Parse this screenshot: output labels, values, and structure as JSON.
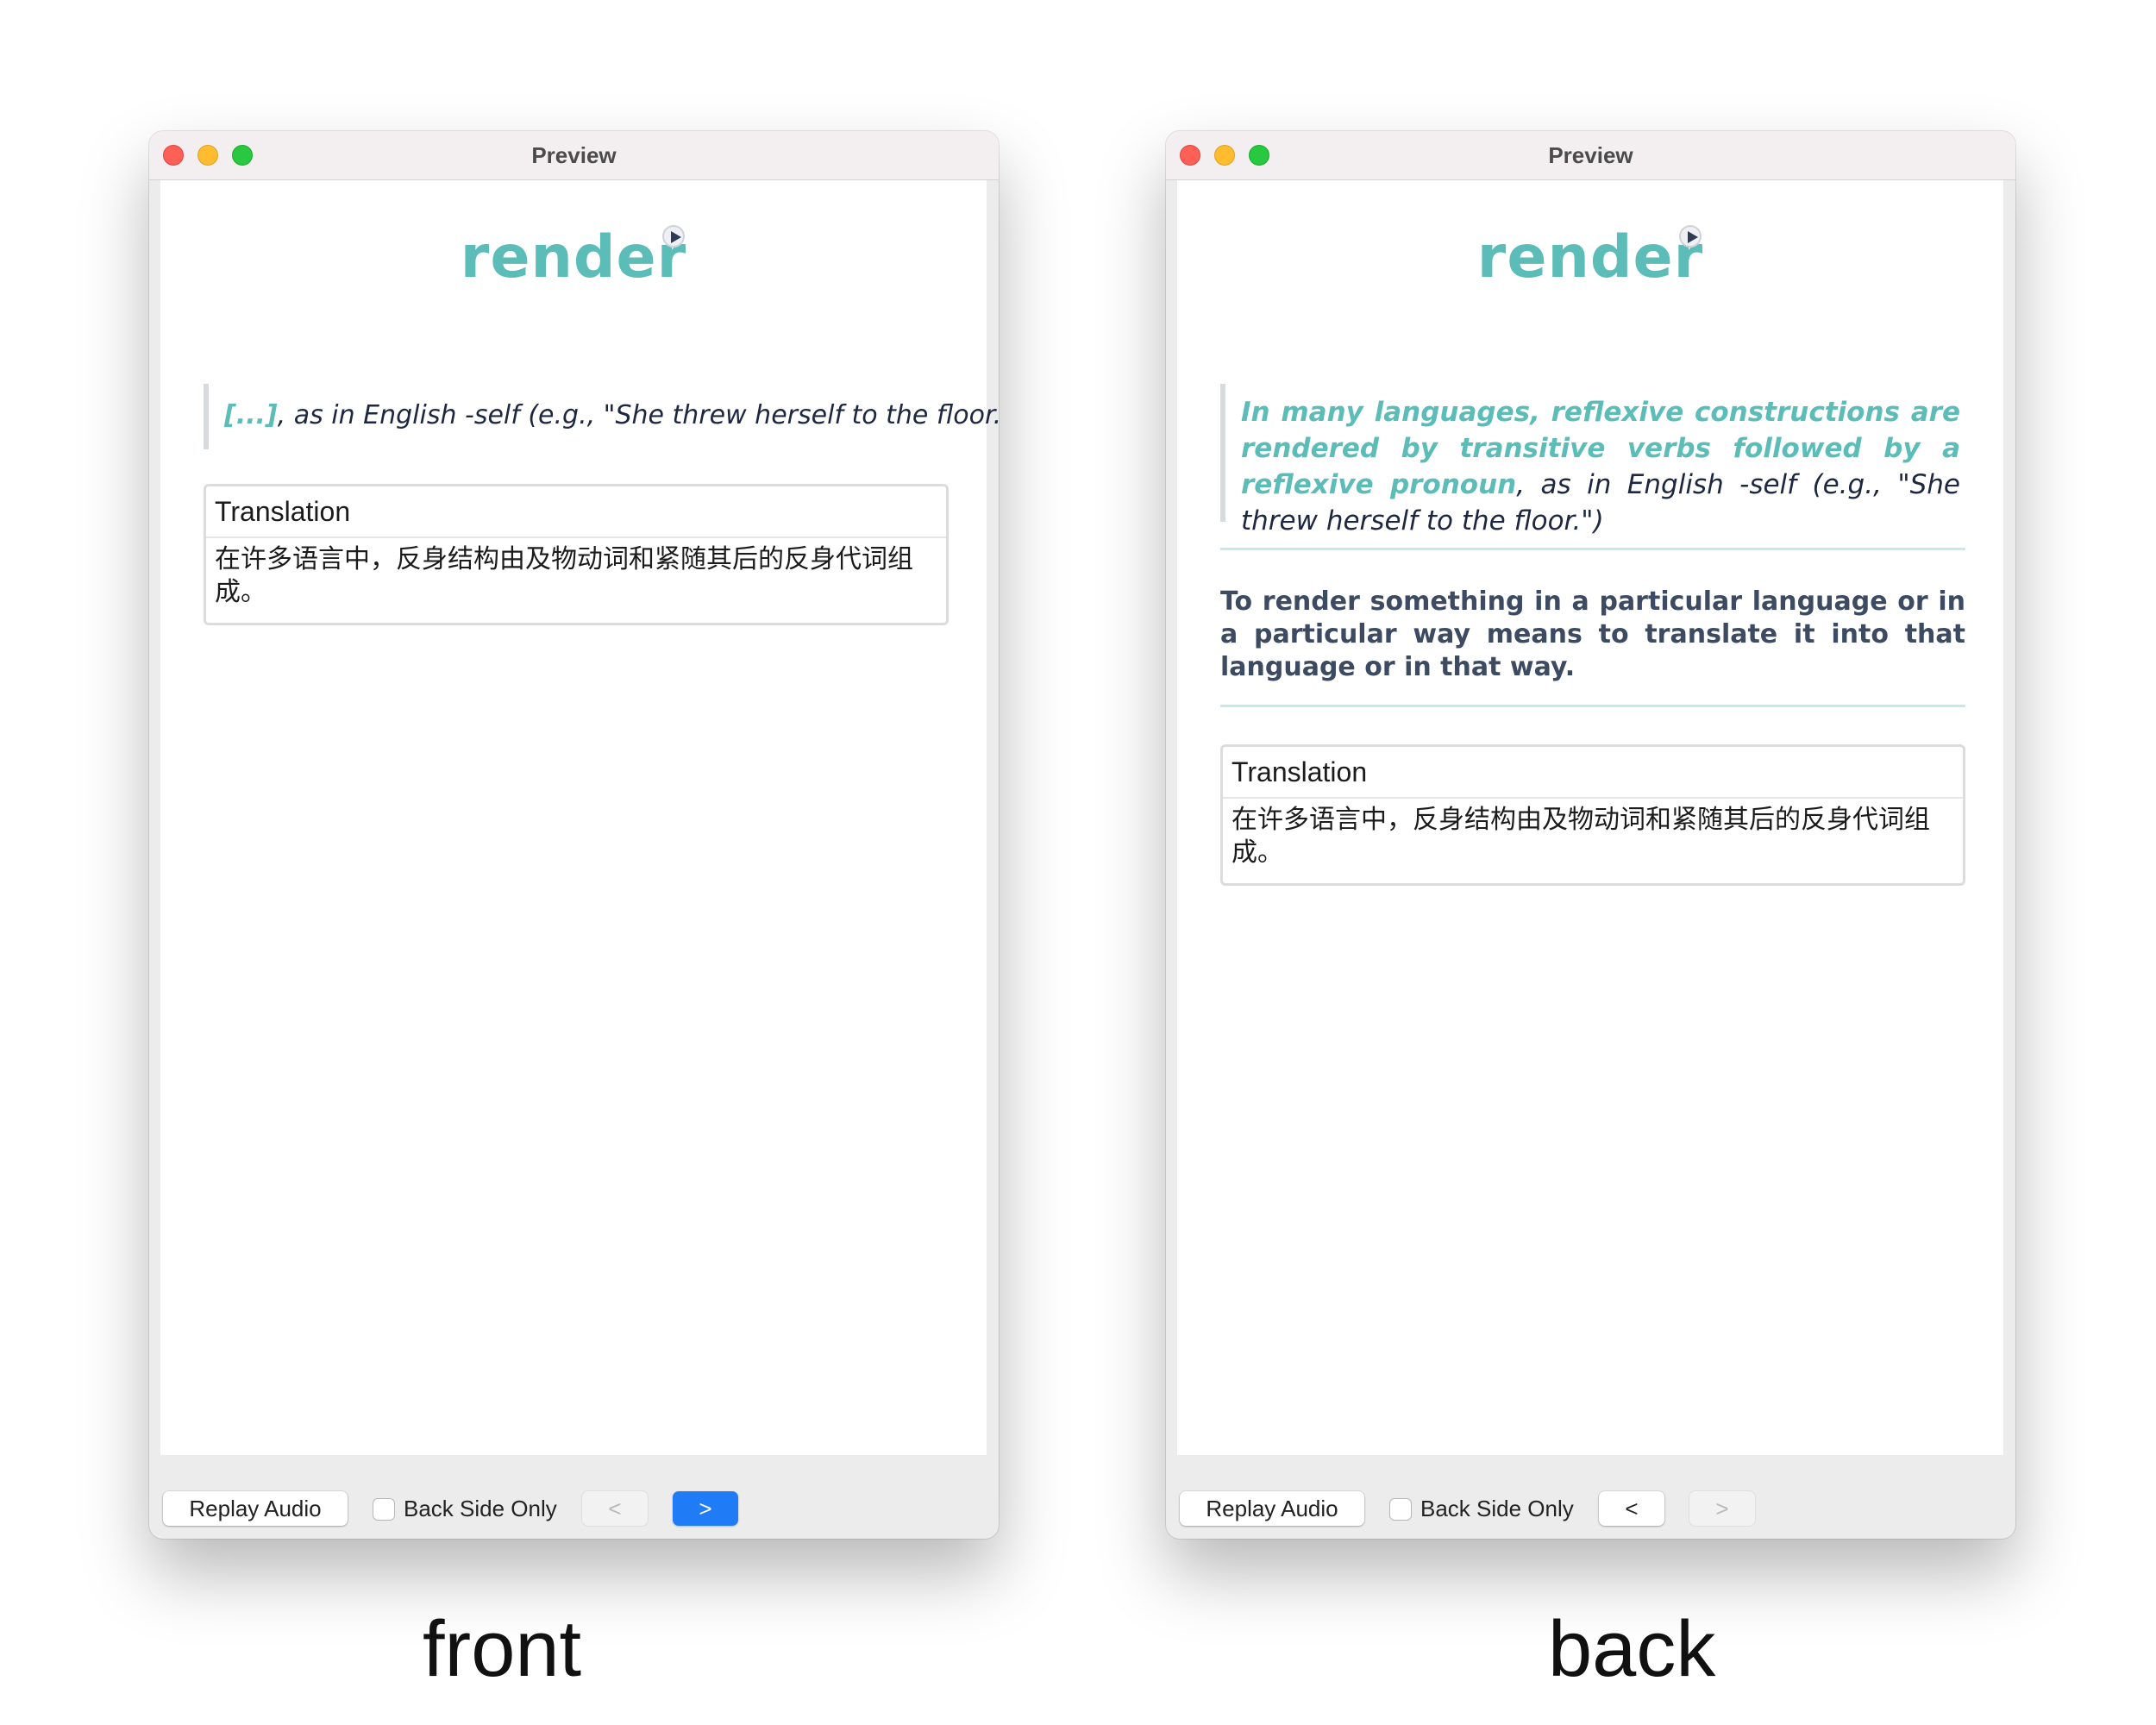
{
  "front": {
    "window_title": "Preview",
    "word": "render",
    "quote": {
      "cloze": "[...]",
      "rest": ", as in English -self (e.g., \"She threw herself to the floor.\")"
    },
    "translation": {
      "heading": "Translation",
      "text": "在许多语言中，反身结构由及物动词和紧随其后的反身代词组成。"
    },
    "toolbar": {
      "replay_label": "Replay Audio",
      "back_side_only_label": "Back Side Only",
      "back_side_only_checked": false,
      "prev_label": "<",
      "next_label": ">"
    },
    "caption": "front"
  },
  "back": {
    "window_title": "Preview",
    "word": "render",
    "quote": {
      "highlight": "In many languages, reflexive constructions are rendered by transitive verbs followed by a reflexive pronoun",
      "rest": ", as in English -self (e.g., \"She threw herself to the floor.\")"
    },
    "definition": "To render something in a particular language or in a particular way means to translate it into that language or in that way.",
    "translation": {
      "heading": "Translation",
      "text": "在许多语言中，反身结构由及物动词和紧随其后的反身代词组成。"
    },
    "toolbar": {
      "replay_label": "Replay Audio",
      "back_side_only_label": "Back Side Only",
      "back_side_only_checked": false,
      "prev_label": "<",
      "next_label": ">"
    },
    "caption": "back"
  },
  "colors": {
    "accent_teal": "#5cbcb8",
    "text_navy": "#1d2740",
    "definition_slate": "#3c4a62",
    "primary_button_blue": "#1f7bf6"
  },
  "icons": {
    "window_controls": [
      "close-icon",
      "minimize-icon",
      "zoom-icon"
    ],
    "audio": "play-audio-icon"
  }
}
